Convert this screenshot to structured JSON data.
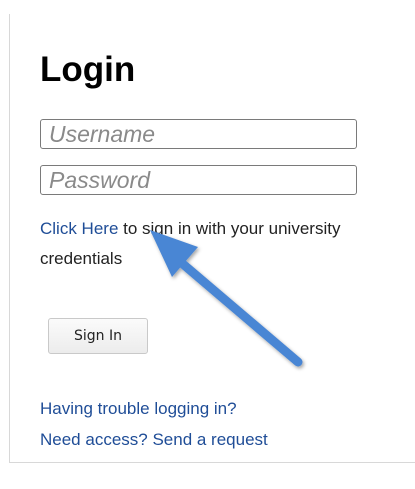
{
  "login": {
    "title": "Login",
    "username_placeholder": "Username",
    "password_placeholder": "Password",
    "info_link": "Click Here",
    "info_text": " to sign in with your university credentials",
    "sign_in_label": "Sign In",
    "trouble_link": "Having trouble logging in?",
    "access_link": "Need access? Send a request"
  },
  "colors": {
    "link": "#1f4d97",
    "annotation_arrow": "#4a86d4"
  },
  "icons": {
    "annotation": "arrow-pointer-icon"
  }
}
